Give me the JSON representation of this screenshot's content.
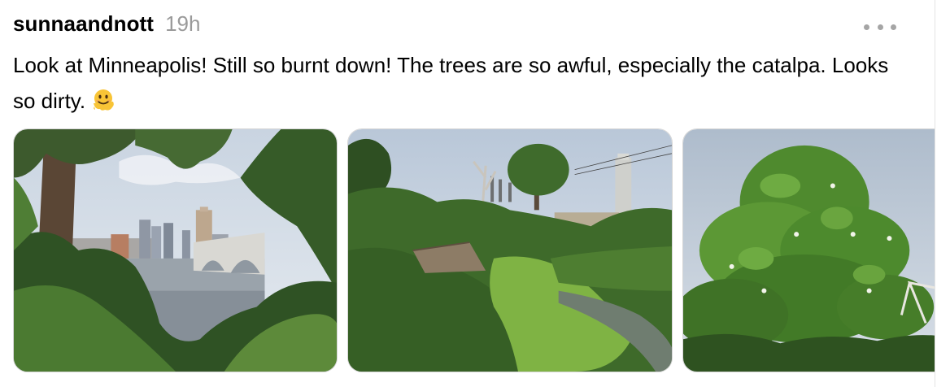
{
  "post": {
    "username": "sunnaandnott",
    "time": "19h",
    "caption": "Look at Minneapolis! Still so burnt down! The trees are so awful, especially the catalpa. Looks so dirty.",
    "emoji": "melting-face-emoji",
    "more_icon": "more-options-icon"
  },
  "media": [
    {
      "description": "photo-riverside-city-view"
    },
    {
      "description": "photo-overgrown-ravine"
    },
    {
      "description": "photo-catalpa-tree"
    }
  ]
}
